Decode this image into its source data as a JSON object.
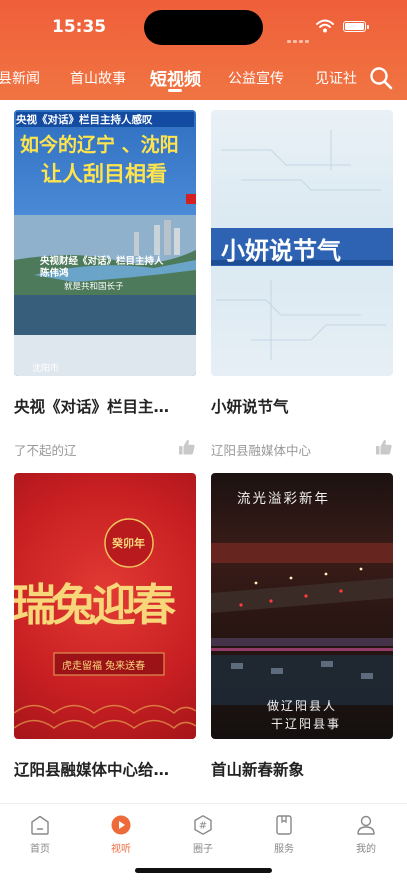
{
  "status": {
    "time": "15:35"
  },
  "tabs": [
    {
      "label": "县新闻"
    },
    {
      "label": "首山故事"
    },
    {
      "label": "短视频"
    },
    {
      "label": "公益宣传"
    },
    {
      "label": "见证社"
    }
  ],
  "cards": [
    {
      "title": "央视《对话》栏目主…",
      "source": "了不起的辽",
      "thumb": {
        "top_caption": "央视《对话》栏目主持人感叹",
        "headline_1": "如今的辽宁 、沈阳",
        "headline_2": "让人刮目相看",
        "sub_1": "央视财经《对话》栏目主持人",
        "sub_2": "陈伟鸿",
        "sub_3": "就是共和国长子",
        "corner": "沈阳市"
      }
    },
    {
      "title": "小妍说节气",
      "source": "辽阳县融媒体中心",
      "thumb": {
        "headline": "小妍说节气"
      }
    },
    {
      "title": "辽阳县融媒体中心给…",
      "source": "",
      "thumb": {
        "badge": "癸卯年",
        "calligraphy": "瑞兔迎春",
        "banner": "虎走留福  兔来送春"
      }
    },
    {
      "title": "首山新春新象",
      "source": "",
      "thumb": {
        "top": "流光溢彩新年",
        "bottom_1": "做辽阳县人",
        "bottom_2": "干辽阳县事"
      }
    }
  ],
  "tabbar": [
    {
      "label": "首页",
      "icon": "home-icon"
    },
    {
      "label": "视听",
      "icon": "play-icon"
    },
    {
      "label": "圈子",
      "icon": "hash-icon"
    },
    {
      "label": "服务",
      "icon": "bookmark-icon"
    },
    {
      "label": "我的",
      "icon": "person-icon"
    }
  ],
  "colors": {
    "accent": "#ef6a3b",
    "header": "#f06b3f"
  }
}
